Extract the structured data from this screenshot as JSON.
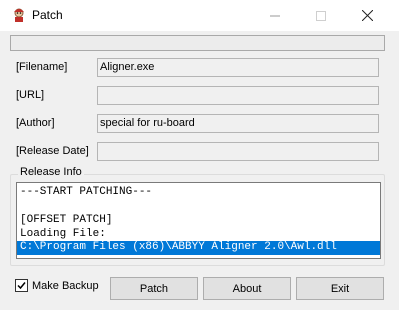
{
  "window": {
    "title": "Patch"
  },
  "fields": {
    "filename": {
      "label": "[Filename]",
      "value": "Aligner.exe"
    },
    "url": {
      "label": "[URL]",
      "value": ""
    },
    "author": {
      "label": "[Author]",
      "value": "special for ru-board"
    },
    "release_date": {
      "label": "[Release Date]",
      "value": ""
    }
  },
  "release_info": {
    "title": "Release Info",
    "lines": [
      "---START PATCHING---",
      "",
      "[OFFSET PATCH]",
      "Loading File:",
      "C:\\Program Files (x86)\\ABBYY Aligner 2.0\\Awl.dll"
    ],
    "selected_line": 4
  },
  "options": {
    "make_backup_label": "Make Backup",
    "make_backup_checked": true
  },
  "buttons": {
    "patch": "Patch",
    "about": "About",
    "exit": "Exit"
  },
  "progress": {
    "fraction": 0
  },
  "colors": {
    "selection": "#0078d7",
    "window_bg": "#f0f0f0"
  }
}
